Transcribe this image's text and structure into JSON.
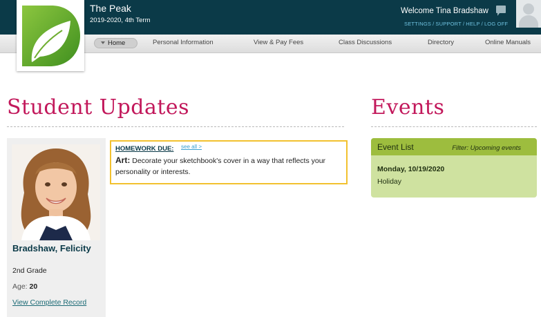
{
  "header": {
    "school_name": "The Peak",
    "term": "2019-2020, 4th Term",
    "welcome": "Welcome Tina Bradshaw",
    "links": [
      "SETTINGS",
      "SUPPORT",
      "HELP",
      "LOG OFF"
    ],
    "icons": {
      "messages": "message-icon",
      "avatar": "user-avatar-icon",
      "logo": "leaf-logo-icon"
    }
  },
  "nav": {
    "items": [
      "Home",
      "Personal Information",
      "View & Pay Fees",
      "Class Discussions",
      "Directory",
      "Online Manuals"
    ],
    "active": "Home"
  },
  "updates": {
    "title": "Student Updates",
    "student": {
      "name": "Bradshaw, Felicity",
      "grade": "2nd Grade",
      "age_label": "Age:",
      "age": "20",
      "record_link": "View Complete Record"
    },
    "homework": {
      "title": "HOMEWORK DUE:",
      "see_all": "see all >",
      "subject": "Art:",
      "text": "Decorate your sketchbook's cover in a way that reflects your personality or interests."
    }
  },
  "events": {
    "title": "Events",
    "list_label": "Event List",
    "filter": "Filter: Upcoming events",
    "items": [
      {
        "date": "Monday, 10/19/2020",
        "name": "Holiday"
      }
    ]
  },
  "colors": {
    "header_bg": "#0b3a48",
    "title_accent": "#c2185b",
    "homework_border": "#f2c12e",
    "events_header": "#9dbd3e",
    "events_bg": "#cfe2a0"
  }
}
